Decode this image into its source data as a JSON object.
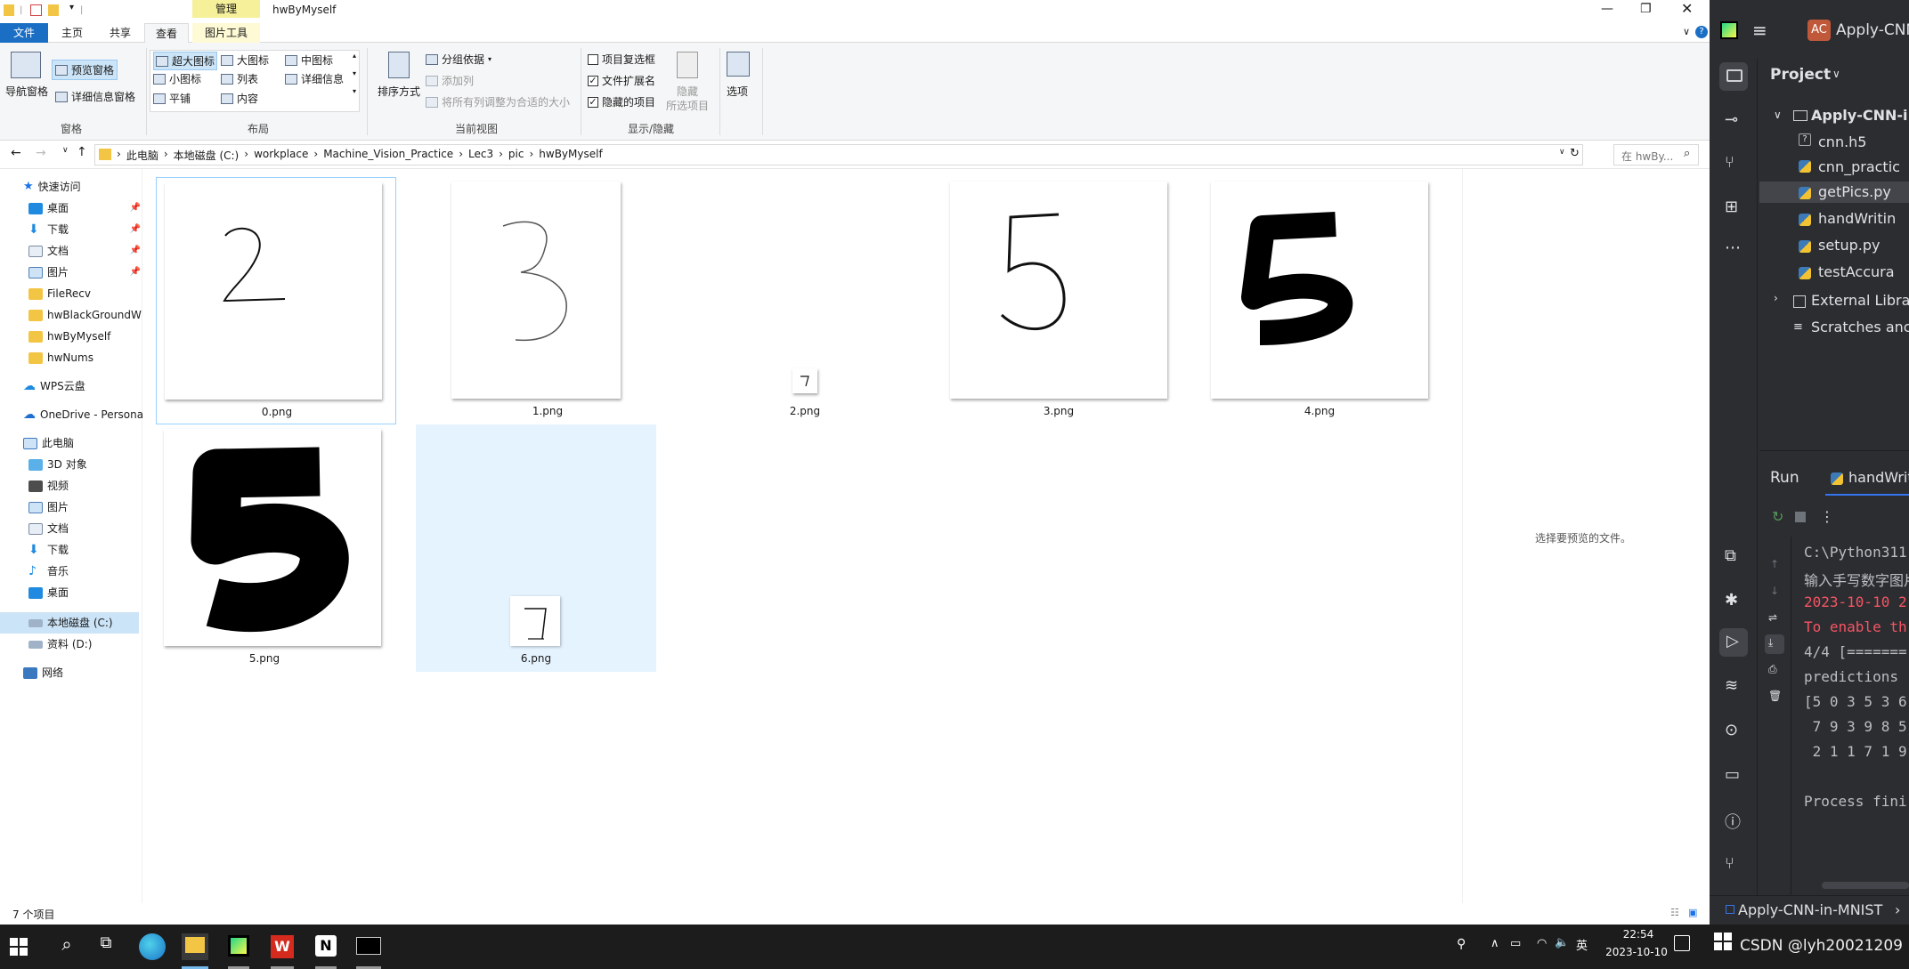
{
  "explorer": {
    "title": "hwByMyself",
    "manage_tab": "管理",
    "tabs": [
      "文件",
      "主页",
      "共享",
      "查看",
      "图片工具"
    ],
    "ribbon": {
      "pane": {
        "nav_pane": "导航窗格",
        "preview_pane": "预览窗格",
        "details_pane": "详细信息窗格",
        "label": "窗格"
      },
      "layout": {
        "items": [
          "超大图标",
          "大图标",
          "中图标",
          "小图标",
          "列表",
          "详细信息",
          "平铺",
          "内容"
        ],
        "label": "布局"
      },
      "current_view": {
        "sort": "排序方式",
        "group_by": "分组依据",
        "add_columns": "添加列",
        "fit_columns": "将所有列调整为合适的大小",
        "label": "当前视图"
      },
      "show_hide": {
        "item_checkboxes": "项目复选框",
        "file_ext": "文件扩展名",
        "hidden_items": "隐藏的项目",
        "hide": "隐藏",
        "selected_items": "所选项目",
        "label": "显示/隐藏"
      },
      "options": "选项"
    },
    "breadcrumb": [
      "此电脑",
      "本地磁盘 (C:)",
      "workplace",
      "Machine_Vision_Practice",
      "Lec3",
      "pic",
      "hwByMyself"
    ],
    "search_placeholder": "在 hwBy...",
    "nav": {
      "quick_access": "快速访问",
      "quick_items": [
        "桌面",
        "下载",
        "文档",
        "图片",
        "FileRecv",
        "hwBlackGroundW",
        "hwByMyself",
        "hwNums"
      ],
      "wps": "WPS云盘",
      "onedrive": "OneDrive - Persona",
      "this_pc": "此电脑",
      "pc_items": [
        "3D 对象",
        "视频",
        "图片",
        "文档",
        "下载",
        "音乐",
        "桌面",
        "本地磁盘 (C:)",
        "资料 (D:)"
      ],
      "network": "网络"
    },
    "files": [
      "0.png",
      "1.png",
      "2.png",
      "3.png",
      "4.png",
      "5.png",
      "6.png"
    ],
    "preview_hint": "选择要预览的文件。",
    "status": "7 个项目"
  },
  "pycharm": {
    "project_badge": "AC",
    "project_name": "Apply-CNN",
    "project_label": "Project",
    "tree": {
      "root": "Apply-CNN-i",
      "files": [
        "cnn.h5",
        "cnn_practic",
        "getPics.py",
        "handWritin",
        "setup.py",
        "testAccura"
      ],
      "external": "External Libra",
      "scratches": "Scratches anc"
    },
    "run_label": "Run",
    "run_tab": "handWrit",
    "console": [
      {
        "text": "C:\\Python311",
        "color": "#bcbec4"
      },
      {
        "text": "输入手写数字图片",
        "color": "#bcbec4"
      },
      {
        "text": "2023-10-10 2",
        "color": "#f75464"
      },
      {
        "text": "To enable th",
        "color": "#f75464"
      },
      {
        "text": "4/4 [=======",
        "color": "#bcbec4"
      },
      {
        "text": "predictions ",
        "color": "#bcbec4"
      },
      {
        "text": "[5 0 3 5 3 6",
        "color": "#bcbec4"
      },
      {
        "text": " 7 9 3 9 8 5",
        "color": "#bcbec4"
      },
      {
        "text": " 2 1 1 7 1 9",
        "color": "#bcbec4"
      },
      {
        "text": "",
        "color": "#bcbec4"
      },
      {
        "text": "Process fini",
        "color": "#bcbec4"
      }
    ],
    "footer": "Apply-CNN-in-MNIST"
  },
  "taskbar": {
    "time": "22:54",
    "date": "2023-10-10",
    "lang": "英",
    "watermark": "CSDN @lyh20021209"
  }
}
